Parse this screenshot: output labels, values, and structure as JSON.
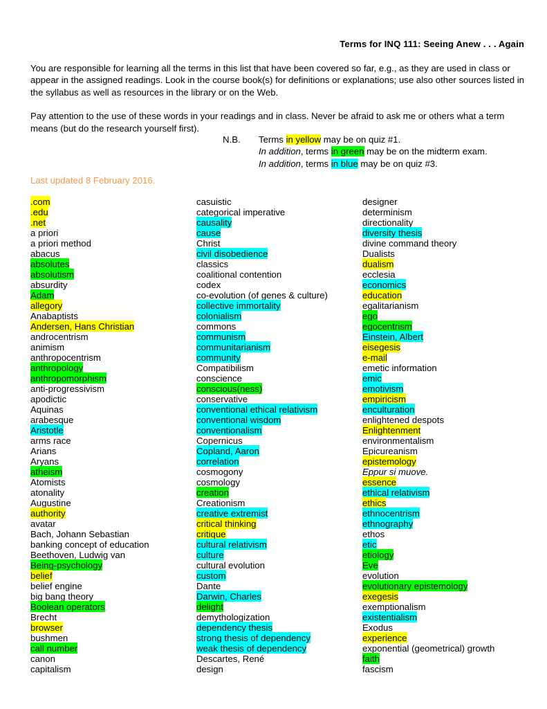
{
  "header": {
    "title": "Terms for INQ 111: Seeing Anew . . . Again"
  },
  "intro": {
    "paragraph1": "You are responsible for learning all the terms in this list that have been covered so far, e.g., as they are used in class or appear in the assigned readings. Look in the course book(s) for definitions or explanations; use also other sources listed in the syllabus as well as resources in the library or on the Web.",
    "paragraph2": "Pay attention to the use of these words in your readings and in class. Never be afraid to ask me or others what a term means (but do the research yourself first)."
  },
  "nb": {
    "label": "N.B.",
    "line1_pre": "Terms ",
    "line1_hl": "in yellow",
    "line1_post": " may be on quiz #1.",
    "line2_ital": "In addition",
    "line2_pre": ", terms ",
    "line2_hl": "in green",
    "line2_post": " may be on the midterm exam.",
    "line3_ital": "In addition",
    "line3_pre": ", terms ",
    "line3_hl": "in blue",
    "line3_post": " may be on quiz #3."
  },
  "last_updated": "Last updated 8 February 2016.",
  "legend": {
    "yellow": "#FFFF00",
    "green": "#00FF00",
    "blue": "#00FFFF",
    "accent_orange": "#F79646"
  },
  "columns": [
    {
      "index": 0,
      "terms": [
        {
          "text": ".com",
          "hl": "yellow"
        },
        {
          "text": ".edu",
          "hl": "yellow"
        },
        {
          "text": ".net",
          "hl": "yellow"
        },
        {
          "text": "a priori",
          "hl": "none"
        },
        {
          "text": "a priori method",
          "hl": "none"
        },
        {
          "text": "abacus",
          "hl": "none"
        },
        {
          "text": "absolutes",
          "hl": "green"
        },
        {
          "text": "absolutism",
          "hl": "green"
        },
        {
          "text": "absurdity",
          "hl": "none"
        },
        {
          "text": "Adam",
          "hl": "green"
        },
        {
          "text": "allegory",
          "hl": "yellow"
        },
        {
          "text": "Anabaptists",
          "hl": "none"
        },
        {
          "text": "Andersen, Hans Christian",
          "hl": "yellow"
        },
        {
          "text": "androcentrism",
          "hl": "none"
        },
        {
          "text": "animism",
          "hl": "none"
        },
        {
          "text": "anthropocentrism",
          "hl": "none"
        },
        {
          "text": "anthropology",
          "hl": "green"
        },
        {
          "text": "anthropomorphism",
          "hl": "green"
        },
        {
          "text": "anti-progressivism",
          "hl": "none"
        },
        {
          "text": "apodictic",
          "hl": "none"
        },
        {
          "text": "Aquinas",
          "hl": "none"
        },
        {
          "text": "arabesque",
          "hl": "none"
        },
        {
          "text": "Aristotle",
          "hl": "blue"
        },
        {
          "text": "arms race",
          "hl": "none"
        },
        {
          "text": "Arians",
          "hl": "none"
        },
        {
          "text": "Aryans",
          "hl": "none"
        },
        {
          "text": "atheism",
          "hl": "green"
        },
        {
          "text": "Atomists",
          "hl": "none"
        },
        {
          "text": "atonality",
          "hl": "none"
        },
        {
          "text": "Augustine",
          "hl": "none"
        },
        {
          "text": "authority",
          "hl": "yellow"
        },
        {
          "text": "avatar",
          "hl": "none"
        },
        {
          "text": "Bach, Johann Sebastian",
          "hl": "none"
        },
        {
          "text": "banking concept of education",
          "hl": "none"
        },
        {
          "text": "Beethoven, Ludwig van",
          "hl": "none"
        },
        {
          "text": "Being-psychology",
          "hl": "green"
        },
        {
          "text": "belief",
          "hl": "yellow"
        },
        {
          "text": "belief engine",
          "hl": "none"
        },
        {
          "text": "big bang theory",
          "hl": "none"
        },
        {
          "text": "Boolean operators",
          "hl": "green"
        },
        {
          "text": "Brecht",
          "hl": "none"
        },
        {
          "text": "browser",
          "hl": "yellow"
        },
        {
          "text": "bushmen",
          "hl": "none"
        },
        {
          "text": "call number",
          "hl": "green"
        },
        {
          "text": "canon",
          "hl": "none"
        },
        {
          "text": "capitalism",
          "hl": "none"
        }
      ]
    },
    {
      "index": 1,
      "terms": [
        {
          "text": "casuistic",
          "hl": "none"
        },
        {
          "text": "categorical imperative",
          "hl": "none"
        },
        {
          "text": "causality",
          "hl": "blue"
        },
        {
          "text": "cause",
          "hl": "blue"
        },
        {
          "text": "Christ",
          "hl": "none"
        },
        {
          "text": "civil disobedience",
          "hl": "blue"
        },
        {
          "text": "classics",
          "hl": "none"
        },
        {
          "text": "coalitional contention",
          "hl": "none"
        },
        {
          "text": "codex",
          "hl": "none"
        },
        {
          "text": "co-evolution (of genes & culture)",
          "hl": "none"
        },
        {
          "text": "collective immortality",
          "hl": "blue"
        },
        {
          "text": "colonialism",
          "hl": "blue"
        },
        {
          "text": "commons",
          "hl": "none"
        },
        {
          "text": "communism",
          "hl": "blue"
        },
        {
          "text": "communitarianism",
          "hl": "blue"
        },
        {
          "text": "community",
          "hl": "blue"
        },
        {
          "text": "Compatibilism",
          "hl": "none"
        },
        {
          "text": "conscience",
          "hl": "none"
        },
        {
          "text": "conscious(ness)",
          "hl": "green"
        },
        {
          "text": "conservative",
          "hl": "none"
        },
        {
          "text": "conventional ethical relativism",
          "hl": "blue"
        },
        {
          "text": "conventional wisdom",
          "hl": "blue"
        },
        {
          "text": "conventionalism",
          "hl": "blue"
        },
        {
          "text": "Copernicus",
          "hl": "none"
        },
        {
          "text": "Copland, Aaron",
          "hl": "blue"
        },
        {
          "text": "correlation",
          "hl": "blue"
        },
        {
          "text": "cosmogony",
          "hl": "none"
        },
        {
          "text": "cosmology",
          "hl": "none"
        },
        {
          "text": "creation",
          "hl": "green"
        },
        {
          "text": "Creationism",
          "hl": "none"
        },
        {
          "text": "creative extremist",
          "hl": "blue"
        },
        {
          "text": "critical thinking",
          "hl": "yellow"
        },
        {
          "text": "critique",
          "hl": "yellow"
        },
        {
          "text": "cultural relativism",
          "hl": "blue"
        },
        {
          "text": "culture",
          "hl": "blue"
        },
        {
          "text": "cultural evolution",
          "hl": "none"
        },
        {
          "text": "custom",
          "hl": "blue"
        },
        {
          "text": "Dante",
          "hl": "none"
        },
        {
          "text": "Darwin, Charles",
          "hl": "blue"
        },
        {
          "text": "delight",
          "hl": "green"
        },
        {
          "text": "demythologization",
          "hl": "none"
        },
        {
          "text": "dependency thesis",
          "hl": "blue"
        },
        {
          "text": "strong thesis of dependency",
          "hl": "blue"
        },
        {
          "text": "weak thesis of dependency",
          "hl": "blue"
        },
        {
          "text": "Descartes, René",
          "hl": "none"
        },
        {
          "text": "design",
          "hl": "none"
        }
      ]
    },
    {
      "index": 2,
      "terms": [
        {
          "text": "designer",
          "hl": "none"
        },
        {
          "text": "determinism",
          "hl": "none"
        },
        {
          "text": "directionality",
          "hl": "none"
        },
        {
          "text": "diversity thesis",
          "hl": "blue"
        },
        {
          "text": "divine command theory",
          "hl": "none"
        },
        {
          "text": "Dualists",
          "hl": "none"
        },
        {
          "text": "dualism",
          "hl": "yellow"
        },
        {
          "text": "ecclesia",
          "hl": "none"
        },
        {
          "text": "economics",
          "hl": "blue"
        },
        {
          "text": "education",
          "hl": "yellow"
        },
        {
          "text": "egalitarianism",
          "hl": "none"
        },
        {
          "text": "ego",
          "hl": "green"
        },
        {
          "text": "egocentrism",
          "hl": "green"
        },
        {
          "text": "Einstein, Albert",
          "hl": "blue"
        },
        {
          "text": "eisegesis",
          "hl": "yellow"
        },
        {
          "text": "e-mail",
          "hl": "yellow"
        },
        {
          "text": "emetic information",
          "hl": "none"
        },
        {
          "text": "emic",
          "hl": "blue"
        },
        {
          "text": "emotivism",
          "hl": "blue"
        },
        {
          "text": "empiricism",
          "hl": "yellow"
        },
        {
          "text": "enculturation",
          "hl": "blue"
        },
        {
          "text": "enlightened despots",
          "hl": "none"
        },
        {
          "text": "Enlightenment",
          "hl": "yellow"
        },
        {
          "text": "environmentalism",
          "hl": "none"
        },
        {
          "text": "Epicureanism",
          "hl": "none"
        },
        {
          "text": "epistemology",
          "hl": "yellow"
        },
        {
          "text": "Eppur si muove.",
          "hl": "none",
          "italic": true
        },
        {
          "text": "essence",
          "hl": "yellow"
        },
        {
          "text": "ethical relativism",
          "hl": "blue"
        },
        {
          "text": "ethics",
          "hl": "yellow"
        },
        {
          "text": "ethnocentrism",
          "hl": "blue"
        },
        {
          "text": "ethnography",
          "hl": "blue"
        },
        {
          "text": "ethos",
          "hl": "none"
        },
        {
          "text": "etic",
          "hl": "blue"
        },
        {
          "text": "etiology",
          "hl": "green"
        },
        {
          "text": "Eve",
          "hl": "green"
        },
        {
          "text": "evolution",
          "hl": "none"
        },
        {
          "text": "evolutionary epistemology",
          "hl": "green"
        },
        {
          "text": "exegesis",
          "hl": "yellow"
        },
        {
          "text": "exemptionalism",
          "hl": "none"
        },
        {
          "text": "existentialism",
          "hl": "blue"
        },
        {
          "text": "Exodus",
          "hl": "none"
        },
        {
          "text": "experience",
          "hl": "yellow"
        },
        {
          "text": "exponential (geometrical) growth",
          "hl": "none"
        },
        {
          "text": "faith",
          "hl": "green"
        },
        {
          "text": "fascism",
          "hl": "none"
        }
      ]
    }
  ]
}
